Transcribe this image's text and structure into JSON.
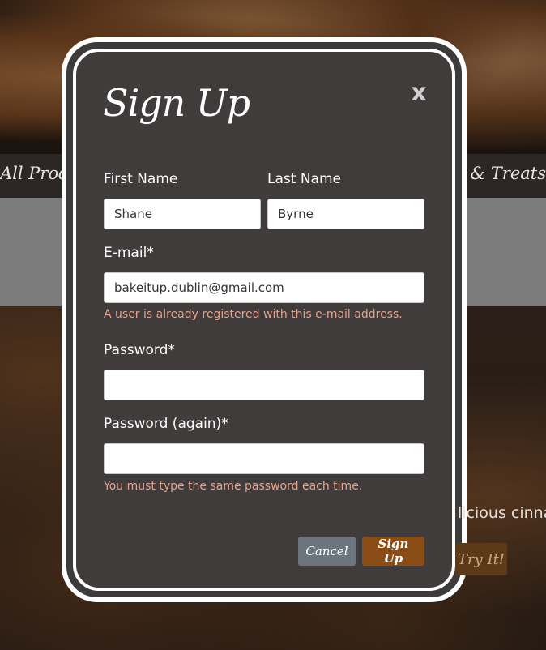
{
  "background": {
    "nav_left": "All Produc",
    "nav_right": "ts & Treats",
    "caption": "licious cinna",
    "try_button": "Try It!"
  },
  "modal": {
    "title": "Sign Up",
    "close_label": "x",
    "first_name": {
      "label": "First Name",
      "value": "Shane"
    },
    "last_name": {
      "label": "Last Name",
      "value": "Byrne"
    },
    "email": {
      "label": "E-mail*",
      "value": "bakeitup.dublin@gmail.com",
      "error": "A user is already registered with this e-mail address."
    },
    "password": {
      "label": "Password*",
      "value": ""
    },
    "password_again": {
      "label": "Password (again)*",
      "value": "",
      "error": "You must type the same password each time."
    },
    "cancel_label": "Cancel",
    "submit_label": "Sign Up"
  }
}
